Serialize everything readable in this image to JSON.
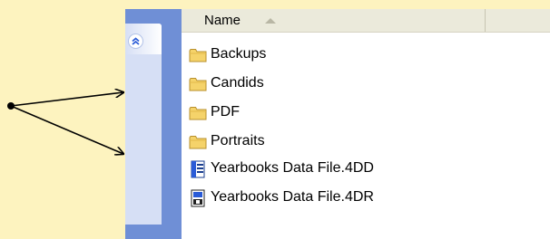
{
  "explorer": {
    "columns": {
      "name_label": "Name"
    },
    "files": [
      {
        "label": "Backups",
        "icon": "folder-icon"
      },
      {
        "label": "Candids",
        "icon": "folder-icon"
      },
      {
        "label": "PDF",
        "icon": "folder-icon"
      },
      {
        "label": "Portraits",
        "icon": "folder-icon"
      },
      {
        "label": "Yearbooks Data File.4DD",
        "icon": "data-file-icon"
      },
      {
        "label": "Yearbooks Data File.4DR",
        "icon": "resource-file-icon"
      }
    ]
  },
  "colors": {
    "callout_background": "#fdf3bf",
    "task_pane_blue": "#6f8fd6",
    "header_bar": "#ebeadb",
    "folder_yellow": "#f5d36a",
    "collapse_chevron": "#2a5bd7"
  },
  "icons": {
    "collapse": "double-chevron-up-icon",
    "sort": "sort-ascending-icon",
    "annotation": "double-arrow-pointer"
  }
}
